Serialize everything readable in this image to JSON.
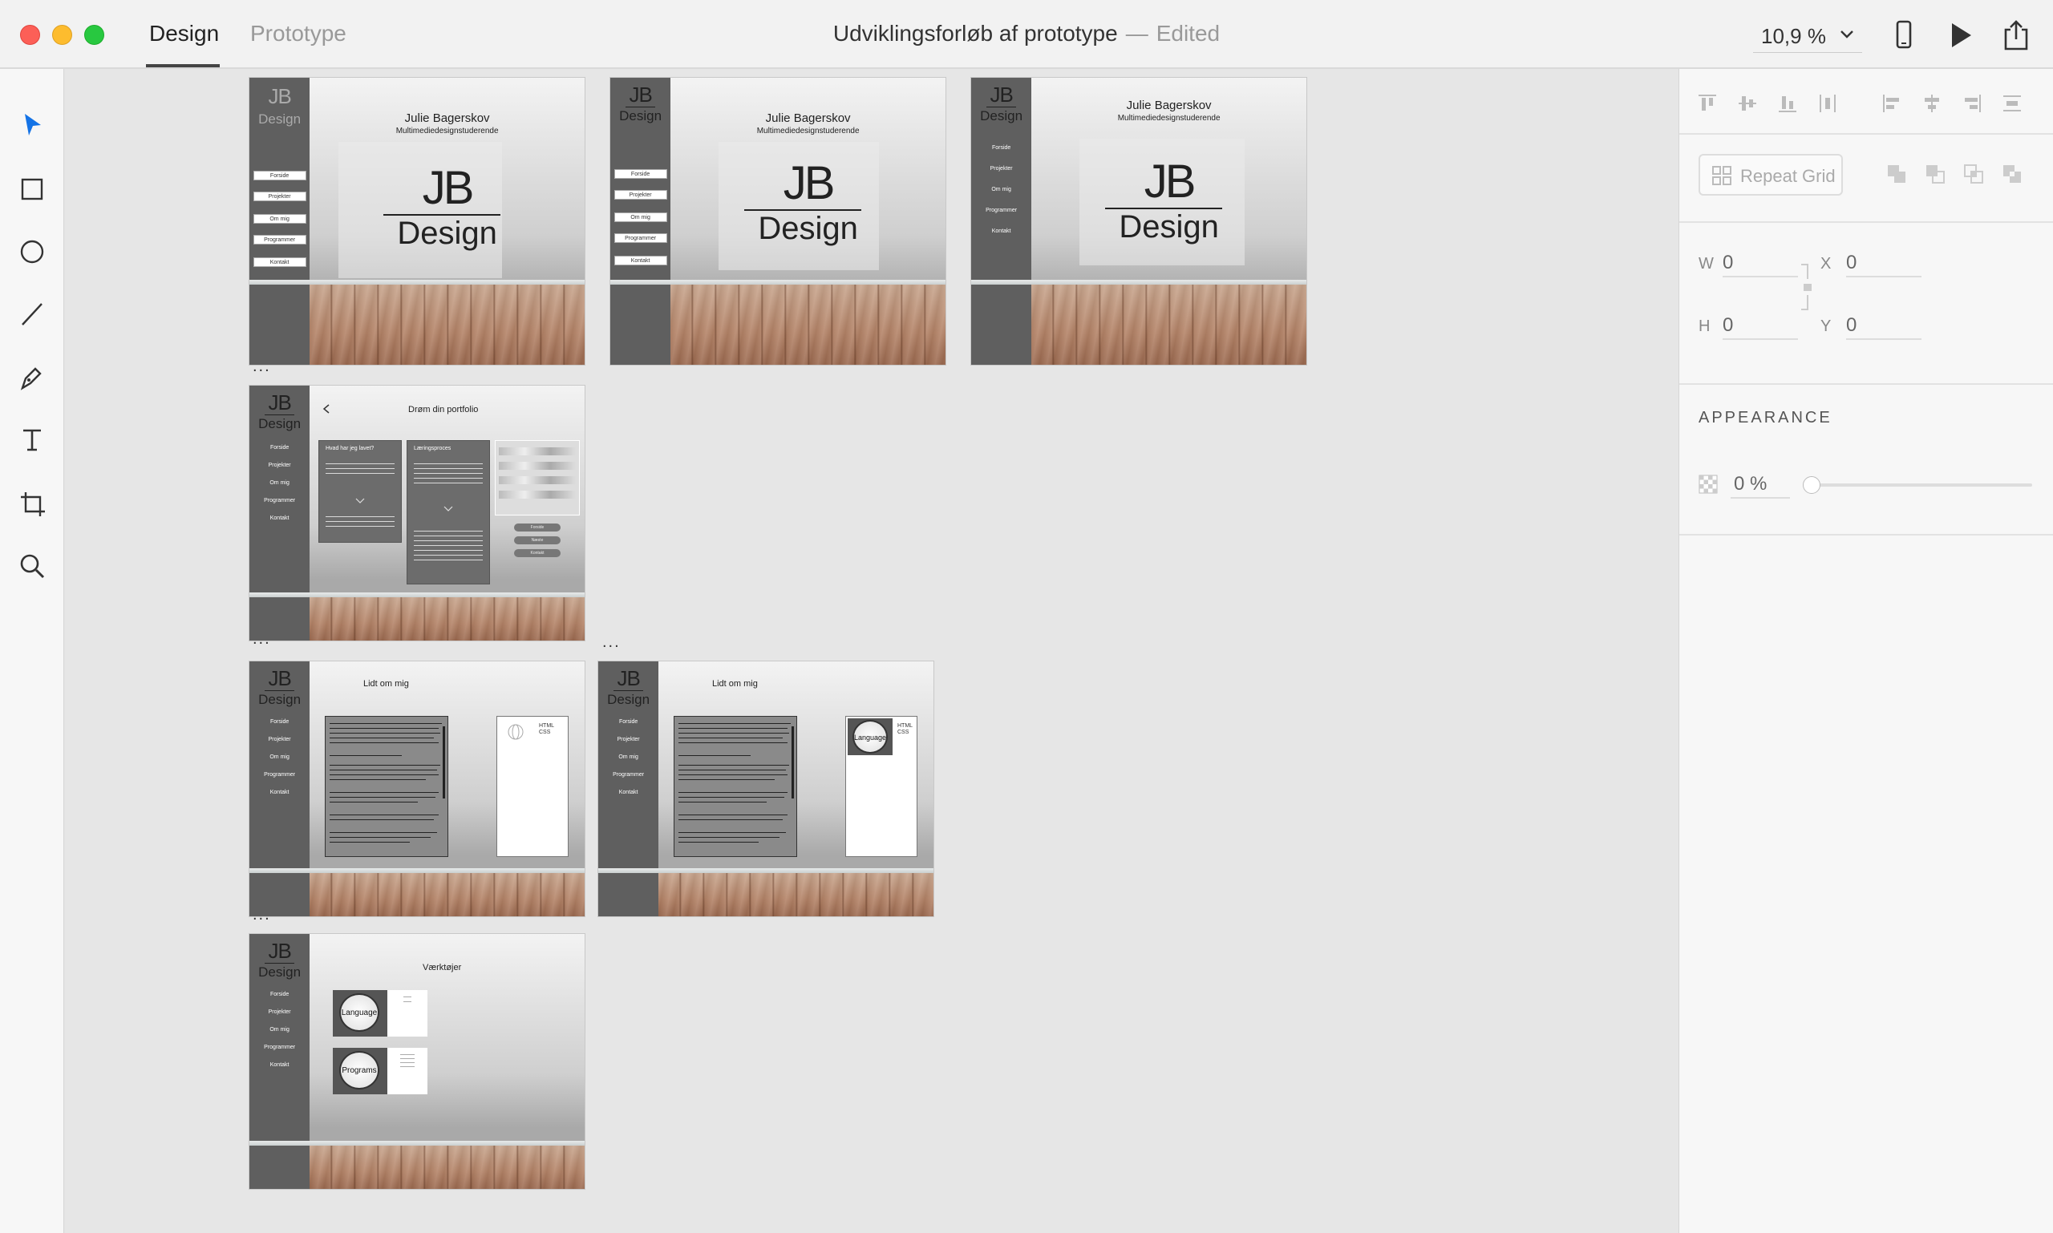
{
  "window": {
    "tabs": [
      {
        "label": "Design"
      },
      {
        "label": "Prototype"
      }
    ],
    "document_title": "Udviklingsforløb af prototype",
    "title_separator": "—",
    "status": "Edited",
    "zoom": "10,9 %"
  },
  "toolbar": {
    "icons": [
      "select-arrow-icon",
      "rectangle-icon",
      "ellipse-icon",
      "line-icon",
      "pen-icon",
      "text-icon",
      "artboard-icon",
      "zoom-icon"
    ]
  },
  "artboards": {
    "logo": {
      "jb": "JB",
      "design": "Design"
    },
    "home": {
      "name": "Julie Bagerskov",
      "subtitle": "Multimediedesignstuderende",
      "big_jb": "JB",
      "big_design": "Design"
    },
    "nav": [
      "Forside",
      "Projekter",
      "Om mig",
      "Programmer",
      "Kontakt"
    ],
    "portfolio": {
      "heading": "Drøm din portfolio",
      "card1_title": "Hvad har jeg lavet?",
      "card2_title": "Læringsproces",
      "buttons": [
        "Forside",
        "Næste",
        "Kontakt"
      ]
    },
    "about": {
      "heading": "Lidt om mig",
      "skills": "HTML CSS",
      "badge": "Language"
    },
    "tools": {
      "heading": "Værktøjer",
      "badge1": "Language",
      "badge2": "Programs"
    },
    "more_indicator": "..."
  },
  "inspector": {
    "repeat_grid": "Repeat Grid",
    "w_label": "W",
    "w_value": "0",
    "h_label": "H",
    "h_value": "0",
    "x_label": "X",
    "x_value": "0",
    "y_label": "Y",
    "y_value": "0",
    "appearance": "APPEARANCE",
    "opacity": "0 %"
  },
  "colors": {
    "accent": "#1473e6",
    "sidebar_grey": "#5f5f5f",
    "close": "#fc5f57",
    "minimize": "#fdbc2e",
    "maximize": "#28c840"
  }
}
